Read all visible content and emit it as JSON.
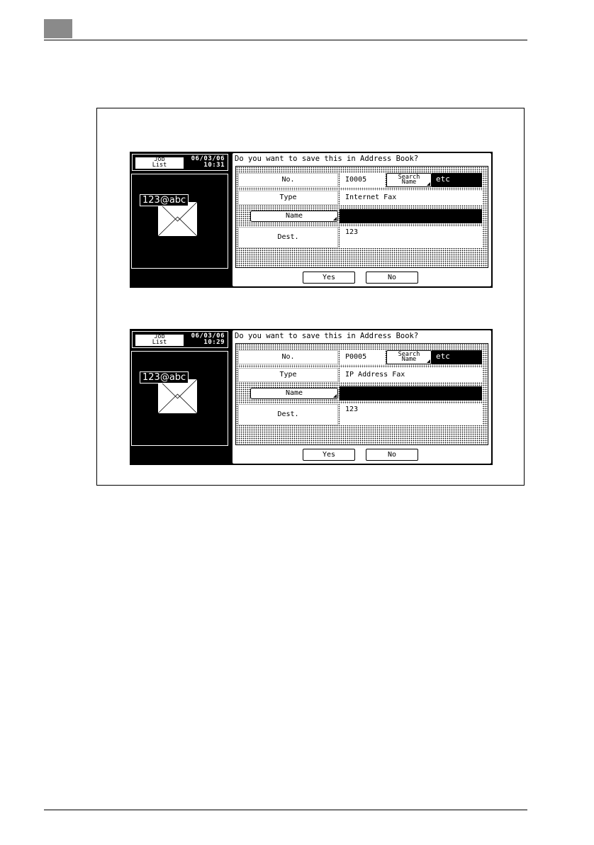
{
  "screens": [
    {
      "job_list_line1": "Job",
      "job_list_line2": "List",
      "date": "06/03/06",
      "time": "10:31",
      "address_label": "123@abc",
      "question": "Do you want to save this in Address Book?",
      "no_label": "No.",
      "no_value": "I0005",
      "search_line1": "Search",
      "search_line2": "Name",
      "etc": "etc",
      "type_label": "Type",
      "type_value": "Internet Fax",
      "name_button": "Name",
      "dest_label": "Dest.",
      "dest_value": "123",
      "yes_button": "Yes",
      "no_button": "No"
    },
    {
      "job_list_line1": "Job",
      "job_list_line2": "List",
      "date": "06/03/06",
      "time": "10:29",
      "address_label": "123@abc",
      "question": "Do you want to save this in Address Book?",
      "no_label": "No.",
      "no_value": "P0005",
      "search_line1": "Search",
      "search_line2": "Name",
      "etc": "etc",
      "type_label": "Type",
      "type_value": "IP Address Fax",
      "name_button": "Name",
      "dest_label": "Dest.",
      "dest_value": "123",
      "yes_button": "Yes",
      "no_button": "No"
    }
  ]
}
